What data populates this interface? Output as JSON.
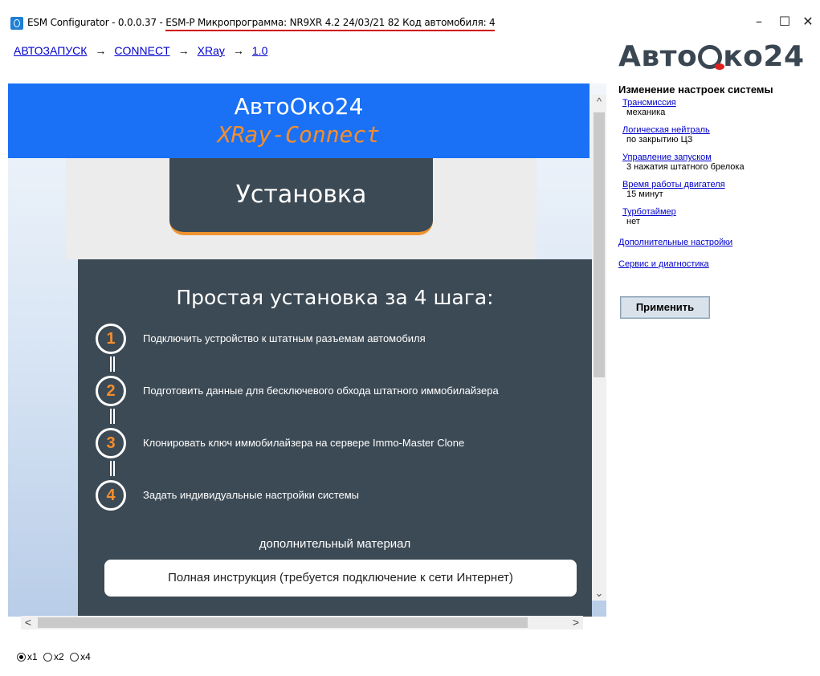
{
  "window": {
    "title": "ESM Configurator - 0.0.0.37 - ESM-P Микропрограмма: NR9XR 4.2 24/03/21 82 Код автомобиля: 4",
    "minimize": "–",
    "maximize": "☐",
    "close": "✕"
  },
  "breadcrumb": {
    "items": [
      "АВТОЗАПУСК",
      "CONNECT",
      "XRay",
      "1.0"
    ],
    "separator": "→"
  },
  "brand": {
    "part1": "Авто",
    "part2": "ко24"
  },
  "web": {
    "banner_title": "АвтоОко24",
    "banner_subtitle": "XRay-Connect",
    "install_tab": "Установка",
    "panel_title": "Простая установка за 4 шага:",
    "steps": [
      {
        "num": "1",
        "text": "Подключить устройство к штатным разъемам автомобиля"
      },
      {
        "num": "2",
        "text": "Подготовить данные для бесключевого обхода штатного иммобилайзера"
      },
      {
        "num": "3",
        "text": "Клонировать ключ иммобилайзера на сервере Immo-Master Clone"
      },
      {
        "num": "4",
        "text": "Задать индивидуальные настройки системы"
      }
    ],
    "extra_label": "дополнительный материал",
    "manual_button": "Полная инструкция (требуется подключение к сети Интернет)"
  },
  "scroll": {
    "up": "^",
    "down": "⌄",
    "left": "<",
    "right": ">"
  },
  "zoom": {
    "options": [
      "x1",
      "x2",
      "x4"
    ],
    "selected": "x1"
  },
  "settings": {
    "heading": "Изменение настроек системы",
    "items": [
      {
        "label": "Трансмиссия",
        "value": "механика"
      },
      {
        "label": "Логическая нейтраль",
        "value": "по закрытию ЦЗ"
      },
      {
        "label": "Управление запуском",
        "value": "3 нажатия штатного брелока"
      },
      {
        "label": "Время работы двигателя",
        "value": "15 минут"
      },
      {
        "label": "Турботаймер",
        "value": "нет"
      }
    ],
    "extra_settings_link": "Дополнительные настройки",
    "service_link": "Сервис и диагностика",
    "apply_button": "Применить"
  },
  "colors": {
    "banner_blue": "#1a71f5",
    "accent_orange": "#f58d2c",
    "panel_dark": "#3c4a55",
    "link_blue": "#0000cc",
    "title_underline": "#d00000"
  }
}
